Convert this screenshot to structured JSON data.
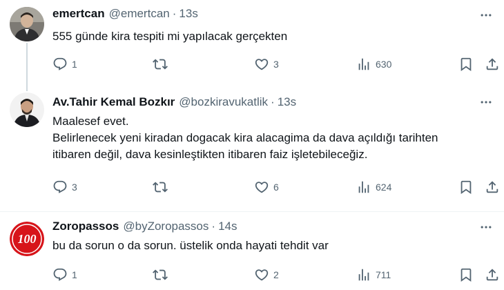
{
  "tweets": [
    {
      "name": "emertcan",
      "handle": "@emertcan",
      "separator": "·",
      "time": "13s",
      "lines": [
        "555 günde kira tespiti mi yapılacak gerçekten"
      ],
      "replies": "1",
      "retweets": "",
      "likes": "3",
      "views": "630"
    },
    {
      "name": "Av.Tahir Kemal Bozkır",
      "handle": "@bozkiravukatlik",
      "separator": "·",
      "time": "13s",
      "lines": [
        "Maalesef evet.",
        "Belirlenecek yeni kiradan dogacak kira alacagima da dava açıldığı tarihten",
        "itibaren değil, dava kesinleştikten itibaren faiz işletebileceğiz."
      ],
      "replies": "3",
      "retweets": "",
      "likes": "6",
      "views": "624"
    },
    {
      "name": "Zoropassos",
      "handle": "@byZoropassos",
      "separator": "·",
      "time": "14s",
      "logo_text": "100",
      "lines": [
        "bu da sorun o da sorun. üstelik onda hayati tehdit var"
      ],
      "replies": "1",
      "retweets": "",
      "likes": "2",
      "views": "711"
    }
  ],
  "icons": {
    "more": "more-horizontal-icon",
    "reply": "reply-icon",
    "retweet": "retweet-icon",
    "like": "heart-icon",
    "views": "views-chart-icon",
    "bookmark": "bookmark-icon",
    "share": "share-icon"
  },
  "colors": {
    "text": "#0f1419",
    "secondary": "#536471",
    "thread_line": "#cfd9de",
    "logo_red": "#d7141a"
  }
}
